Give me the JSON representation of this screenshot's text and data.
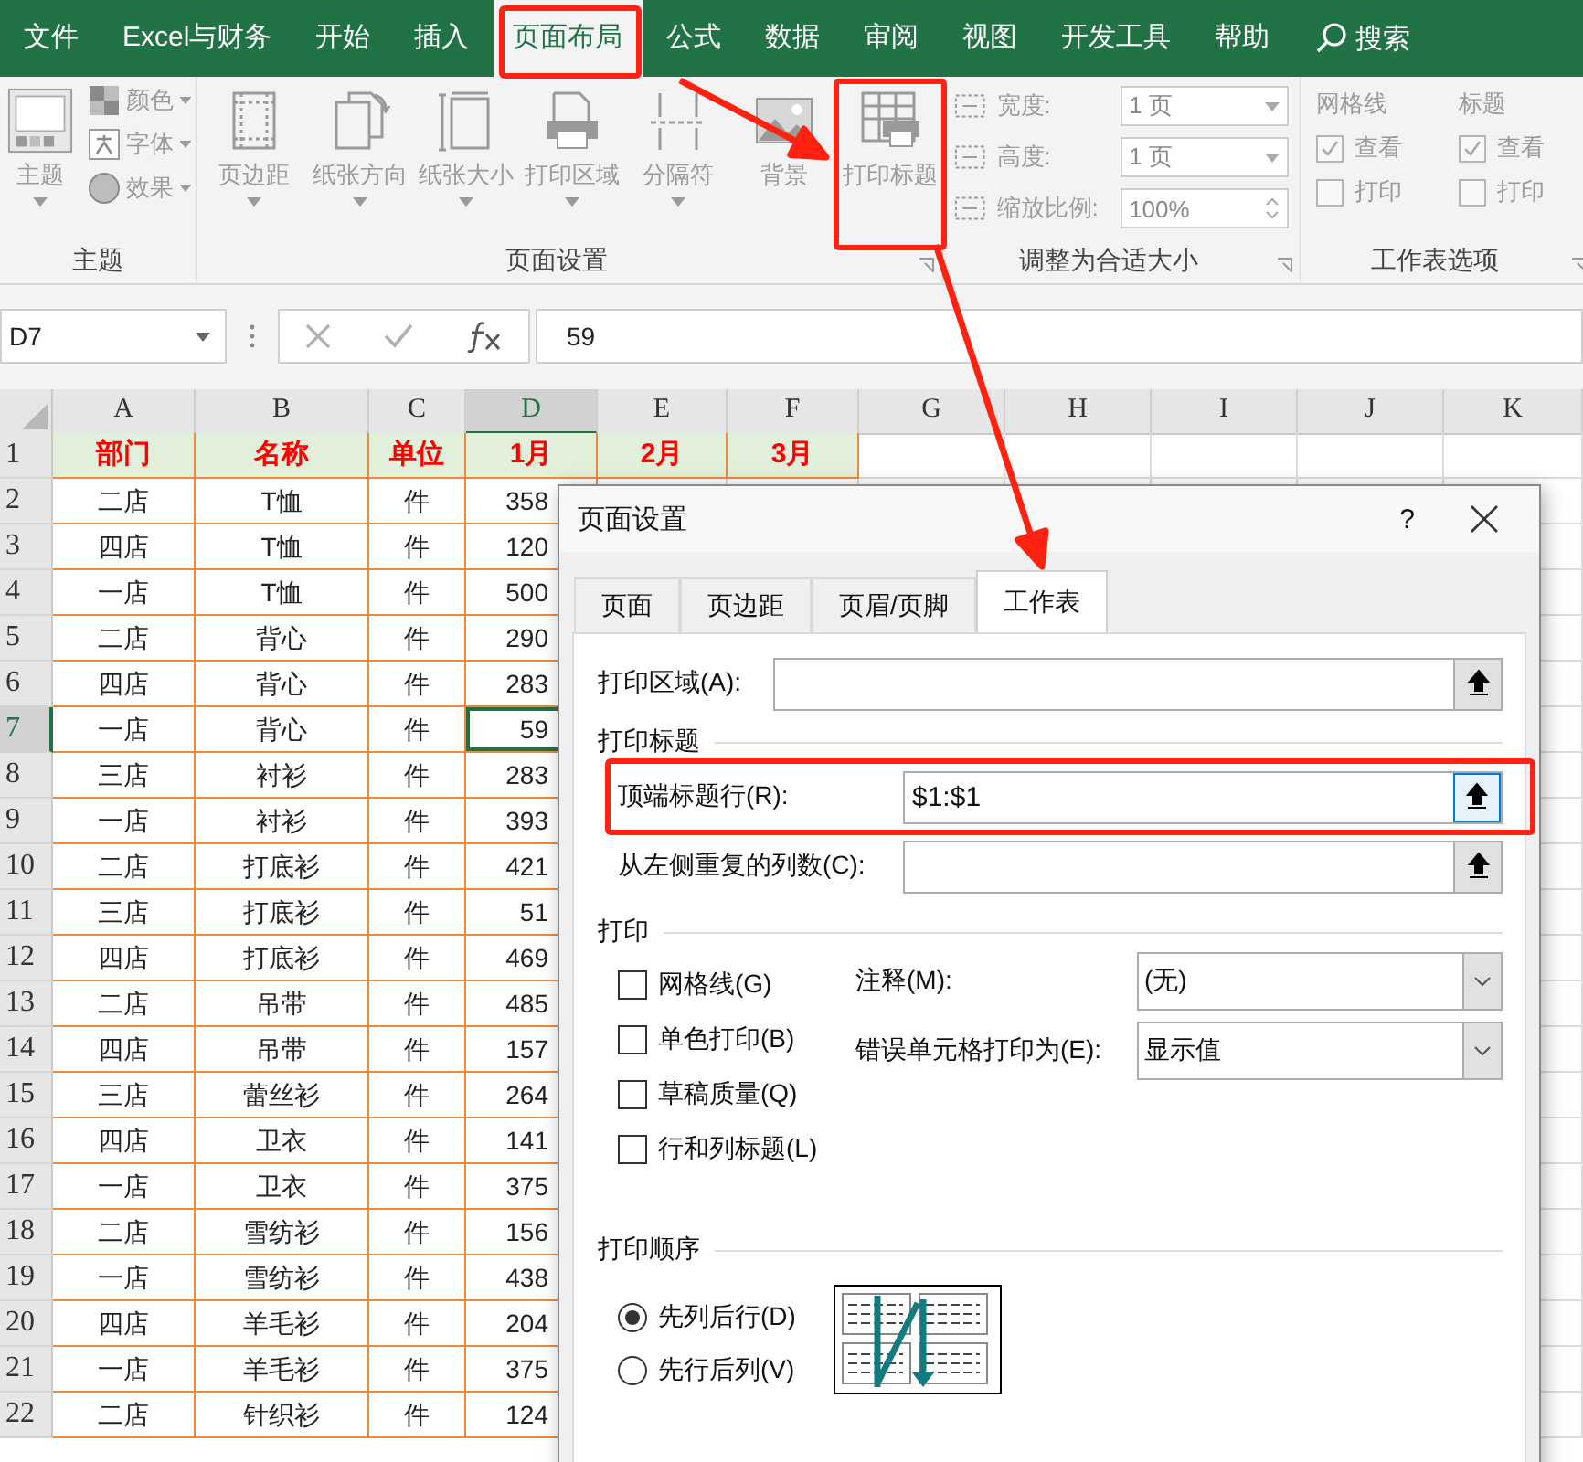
{
  "menu": {
    "tabs": [
      {
        "label": "文件",
        "selected": false,
        "highlighted": false
      },
      {
        "label": "Excel与财务",
        "selected": false,
        "highlighted": false
      },
      {
        "label": "开始",
        "selected": false,
        "highlighted": false
      },
      {
        "label": "插入",
        "selected": false,
        "highlighted": false
      },
      {
        "label": "页面布局",
        "selected": true,
        "highlighted": true
      },
      {
        "label": "公式",
        "selected": false,
        "highlighted": false
      },
      {
        "label": "数据",
        "selected": false,
        "highlighted": false
      },
      {
        "label": "审阅",
        "selected": false,
        "highlighted": false
      },
      {
        "label": "视图",
        "selected": false,
        "highlighted": false
      },
      {
        "label": "开发工具",
        "selected": false,
        "highlighted": false
      },
      {
        "label": "帮助",
        "selected": false,
        "highlighted": false
      }
    ],
    "search": "搜索"
  },
  "ribbon": {
    "theme_group": {
      "title": "主题",
      "button": "主题",
      "small_buttons": [
        "颜色",
        "字体",
        "效果"
      ]
    },
    "page_setup_group": {
      "title": "页面设置",
      "buttons": [
        {
          "label": "页边距",
          "has_menu": true,
          "highlighted": false
        },
        {
          "label": "纸张方向",
          "has_menu": true,
          "highlighted": false
        },
        {
          "label": "纸张大小",
          "has_menu": true,
          "highlighted": false
        },
        {
          "label": "打印区域",
          "has_menu": true,
          "highlighted": false
        },
        {
          "label": "分隔符",
          "has_menu": true,
          "highlighted": false
        },
        {
          "label": "背景",
          "has_menu": false,
          "highlighted": false
        },
        {
          "label": "打印标题",
          "has_menu": false,
          "highlighted": true
        }
      ]
    },
    "scale_group": {
      "title": "调整为合适大小",
      "fields": [
        {
          "label": "宽度:",
          "value": "1 页",
          "kind": "dropdown"
        },
        {
          "label": "高度:",
          "value": "1 页",
          "kind": "dropdown"
        },
        {
          "label": "缩放比例:",
          "value": "100%",
          "kind": "spinner"
        }
      ]
    },
    "sheet_options_group": {
      "title": "工作表选项",
      "columns": [
        {
          "heading": "网格线",
          "options": [
            {
              "label": "查看",
              "checked": true
            },
            {
              "label": "打印",
              "checked": false
            }
          ]
        },
        {
          "heading": "标题",
          "options": [
            {
              "label": "查看",
              "checked": true
            },
            {
              "label": "打印",
              "checked": false
            }
          ]
        }
      ]
    }
  },
  "formula_bar": {
    "name_box": "D7",
    "formula": "59"
  },
  "sheet": {
    "columns": [
      {
        "label": "A",
        "selected": false
      },
      {
        "label": "B",
        "selected": false
      },
      {
        "label": "C",
        "selected": false
      },
      {
        "label": "D",
        "selected": true
      },
      {
        "label": "E",
        "selected": false
      },
      {
        "label": "F",
        "selected": false
      },
      {
        "label": "G",
        "selected": false
      },
      {
        "label": "H",
        "selected": false
      },
      {
        "label": "I",
        "selected": false
      },
      {
        "label": "J",
        "selected": false
      },
      {
        "label": "K",
        "selected": false
      }
    ],
    "header_row": {
      "number": "1",
      "cells": [
        "部门",
        "名称",
        "单位",
        "1月",
        "2月",
        "3月"
      ]
    },
    "rows": [
      {
        "number": "2",
        "selected": false,
        "cells": [
          "二店",
          "T恤",
          "件",
          "358"
        ]
      },
      {
        "number": "3",
        "selected": false,
        "cells": [
          "四店",
          "T恤",
          "件",
          "120"
        ]
      },
      {
        "number": "4",
        "selected": false,
        "cells": [
          "一店",
          "T恤",
          "件",
          "500"
        ]
      },
      {
        "number": "5",
        "selected": false,
        "cells": [
          "二店",
          "背心",
          "件",
          "290"
        ]
      },
      {
        "number": "6",
        "selected": false,
        "cells": [
          "四店",
          "背心",
          "件",
          "283"
        ]
      },
      {
        "number": "7",
        "selected": true,
        "cells": [
          "一店",
          "背心",
          "件",
          "59"
        ]
      },
      {
        "number": "8",
        "selected": false,
        "cells": [
          "三店",
          "衬衫",
          "件",
          "283"
        ]
      },
      {
        "number": "9",
        "selected": false,
        "cells": [
          "一店",
          "衬衫",
          "件",
          "393"
        ]
      },
      {
        "number": "10",
        "selected": false,
        "cells": [
          "二店",
          "打底衫",
          "件",
          "421"
        ]
      },
      {
        "number": "11",
        "selected": false,
        "cells": [
          "三店",
          "打底衫",
          "件",
          "51"
        ]
      },
      {
        "number": "12",
        "selected": false,
        "cells": [
          "四店",
          "打底衫",
          "件",
          "469"
        ]
      },
      {
        "number": "13",
        "selected": false,
        "cells": [
          "二店",
          "吊带",
          "件",
          "485"
        ]
      },
      {
        "number": "14",
        "selected": false,
        "cells": [
          "四店",
          "吊带",
          "件",
          "157"
        ]
      },
      {
        "number": "15",
        "selected": false,
        "cells": [
          "三店",
          "蕾丝衫",
          "件",
          "264"
        ]
      },
      {
        "number": "16",
        "selected": false,
        "cells": [
          "四店",
          "卫衣",
          "件",
          "141"
        ]
      },
      {
        "number": "17",
        "selected": false,
        "cells": [
          "一店",
          "卫衣",
          "件",
          "375"
        ]
      },
      {
        "number": "18",
        "selected": false,
        "cells": [
          "二店",
          "雪纺衫",
          "件",
          "156"
        ]
      },
      {
        "number": "19",
        "selected": false,
        "cells": [
          "一店",
          "雪纺衫",
          "件",
          "438"
        ]
      },
      {
        "number": "20",
        "selected": false,
        "cells": [
          "四店",
          "羊毛衫",
          "件",
          "204"
        ]
      },
      {
        "number": "21",
        "selected": false,
        "cells": [
          "一店",
          "羊毛衫",
          "件",
          "375"
        ]
      },
      {
        "number": "22",
        "selected": false,
        "cells": [
          "二店",
          "针织衫",
          "件",
          "124"
        ]
      }
    ]
  },
  "dialog": {
    "title": "页面设置",
    "help": "?",
    "tabs": [
      {
        "label": "页面",
        "selected": false
      },
      {
        "label": "页边距",
        "selected": false
      },
      {
        "label": "页眉/页脚",
        "selected": false
      },
      {
        "label": "工作表",
        "selected": true
      }
    ],
    "print_area": {
      "label": "打印区域(A):"
    },
    "print_titles": {
      "heading": "打印标题",
      "fields": [
        {
          "label": "顶端标题行(R):",
          "value": "$1:$1",
          "focused": true,
          "highlighted": true
        },
        {
          "label": "从左侧重复的列数(C):",
          "focused": false,
          "highlighted": false
        }
      ]
    },
    "print": {
      "heading": "打印",
      "checkboxes": [
        {
          "label": "网格线(G)",
          "checked": false
        },
        {
          "label": "单色打印(B)",
          "checked": false
        },
        {
          "label": "草稿质量(Q)",
          "checked": false
        },
        {
          "label": "行和列标题(L)",
          "checked": false
        }
      ],
      "dropdowns": [
        {
          "label": "注释(M):",
          "value": "(无)"
        },
        {
          "label": "错误单元格打印为(E):",
          "value": "显示值"
        }
      ]
    },
    "print_order": {
      "heading": "打印顺序",
      "options": [
        {
          "label": "先列后行(D)",
          "selected": true
        },
        {
          "label": "先行后列(V)",
          "selected": false
        }
      ]
    }
  }
}
